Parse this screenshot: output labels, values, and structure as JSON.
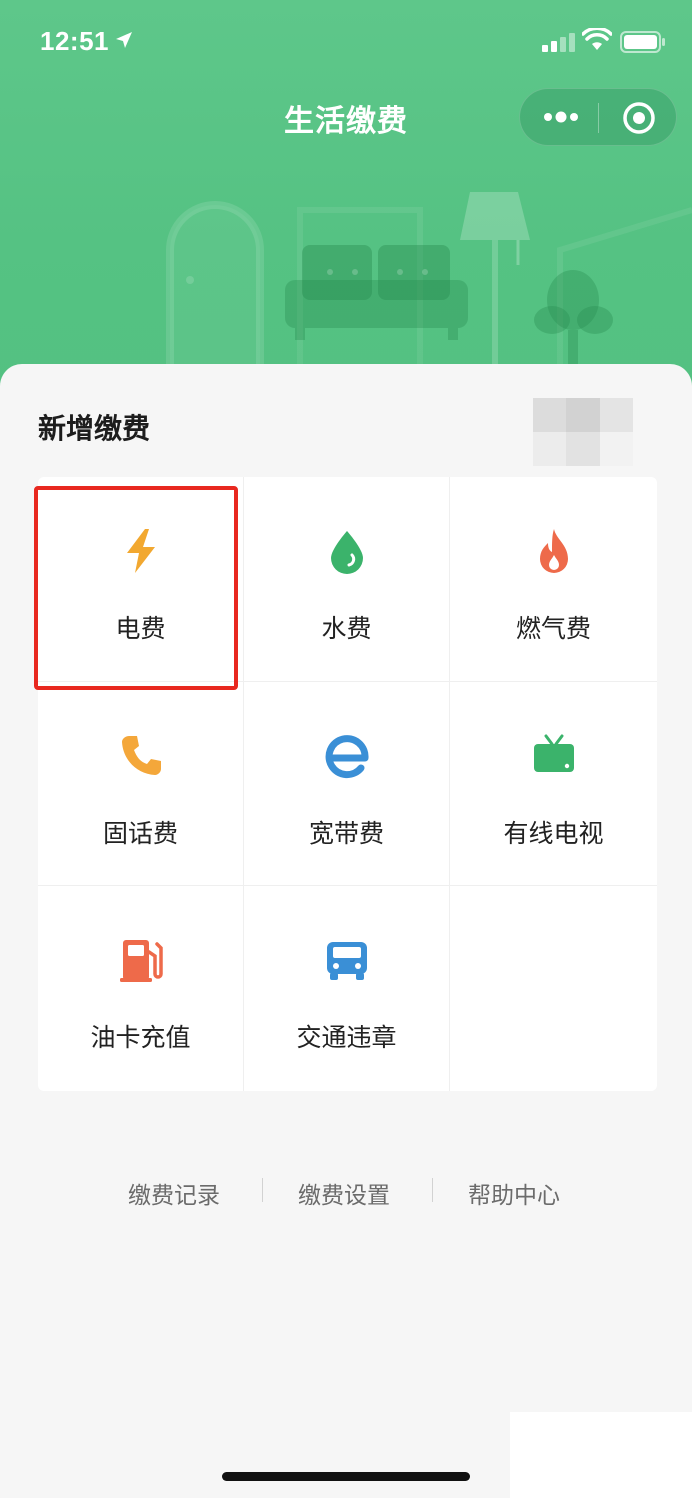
{
  "status_bar": {
    "time": "12:51"
  },
  "header": {
    "title": "生活缴费"
  },
  "section": {
    "title": "新增缴费"
  },
  "services": [
    {
      "label": "电费",
      "icon": "lightning-icon",
      "color": "#f2a830"
    },
    {
      "label": "水费",
      "icon": "water-drop-icon",
      "color": "#3bb36b"
    },
    {
      "label": "燃气费",
      "icon": "flame-icon",
      "color": "#ee6a4a"
    },
    {
      "label": "固话费",
      "icon": "phone-icon",
      "color": "#f4a73a"
    },
    {
      "label": "宽带费",
      "icon": "broadband-e-icon",
      "color": "#3a8fd6"
    },
    {
      "label": "有线电视",
      "icon": "tv-icon",
      "color": "#3bb36b"
    },
    {
      "label": "油卡充值",
      "icon": "fuel-pump-icon",
      "color": "#ee6a4a"
    },
    {
      "label": "交通违章",
      "icon": "car-icon",
      "color": "#3a8fd6"
    }
  ],
  "footer_links": [
    "缴费记录",
    "缴费设置",
    "帮助中心"
  ],
  "colors": {
    "header_green": "#55c283",
    "highlight_red": "#e8281f"
  }
}
